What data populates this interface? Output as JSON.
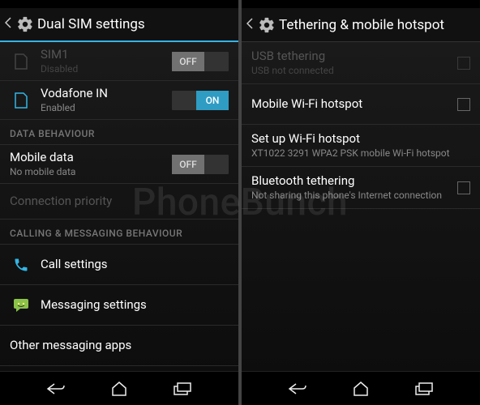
{
  "watermark": "PhoneBunch",
  "left": {
    "title": "Dual SIM settings",
    "sim1": {
      "label": "SIM1",
      "status": "Disabled",
      "toggle": "OFF"
    },
    "sim2": {
      "label": "Vodafone IN",
      "status": "Enabled",
      "toggle": "ON"
    },
    "section_data": "DATA BEHAVIOUR",
    "mobile_data": {
      "label": "Mobile data",
      "status": "No mobile data",
      "toggle": "OFF"
    },
    "conn_priority": "Connection priority",
    "section_calling": "CALLING & MESSAGING BEHAVIOUR",
    "call_settings": "Call settings",
    "messaging_settings": "Messaging settings",
    "other_messaging": "Other messaging apps"
  },
  "right": {
    "title": "Tethering & mobile hotspot",
    "usb": {
      "label": "USB tethering",
      "status": "USB not connected"
    },
    "wifi_hotspot": "Mobile Wi-Fi hotspot",
    "setup_wifi": {
      "label": "Set up Wi-Fi hotspot",
      "status": "XT1022 3291 WPA2 PSK mobile Wi-Fi hotspot"
    },
    "bt": {
      "label": "Bluetooth tethering",
      "status": "Not sharing this phone's Internet connection"
    }
  }
}
